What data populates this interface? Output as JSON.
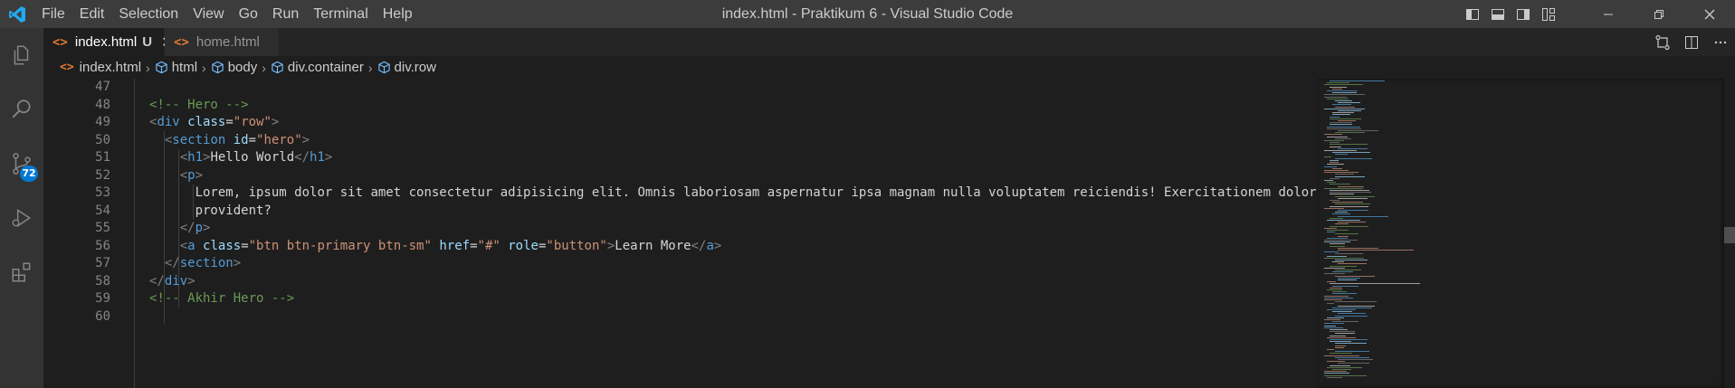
{
  "window": {
    "title": "index.html - Praktikum 6 - Visual Studio Code"
  },
  "menu": [
    "File",
    "Edit",
    "Selection",
    "View",
    "Go",
    "Run",
    "Terminal",
    "Help"
  ],
  "activity": {
    "source_control_badge": "72"
  },
  "tabs": [
    {
      "label": "index.html",
      "modified_marker": "U",
      "active": true
    },
    {
      "label": "home.html",
      "active": false
    }
  ],
  "breadcrumb": [
    "index.html",
    "html",
    "body",
    "div.container",
    "div.row"
  ],
  "editor": {
    "line_numbers": [
      "47",
      "48",
      "49",
      "50",
      "51",
      "52",
      "53",
      "54",
      "55",
      "56",
      "57",
      "58",
      "59",
      "60"
    ],
    "lines": {
      "l48": "<!-- Hero -->",
      "l49": {
        "open": "<",
        "tag": "div",
        "attr": "class",
        "eq": "=",
        "val": "\"row\"",
        "close": ">"
      },
      "l50": {
        "open": "<",
        "tag": "section",
        "attr": "id",
        "eq": "=",
        "val": "\"hero\"",
        "close": ">"
      },
      "l51": {
        "tag": "h1",
        "text": "Hello World"
      },
      "l52": {
        "tag": "p"
      },
      "l53": "Lorem, ipsum dolor sit amet consectetur adipisicing elit. Omnis laboriosam aspernatur ipsa magnam nulla voluptatem reiciendis! Exercitationem doloribus, quos n",
      "l54": "provident?",
      "l55": {
        "tag": "p"
      },
      "l56": {
        "tag": "a",
        "attr1": "class",
        "val1": "\"btn btn-primary btn-sm\"",
        "attr2": "href",
        "val2": "\"#\"",
        "attr3": "role",
        "val3": "\"button\"",
        "text": "Learn More"
      },
      "l57": {
        "tag": "section"
      },
      "l58": {
        "tag": "div"
      },
      "l59": "<!-- Akhir Hero -->"
    }
  },
  "colors": {
    "accent": "#0078d4",
    "html_icon": "#e37933",
    "tag": "#569cd6",
    "attribute": "#9cdcfe",
    "string": "#ce9178",
    "comment": "#6a9955"
  }
}
